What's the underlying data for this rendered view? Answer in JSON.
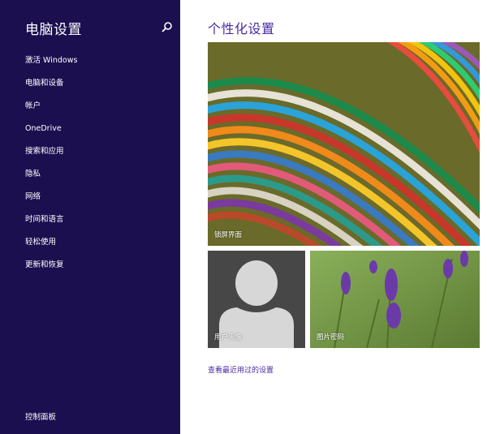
{
  "sidebar": {
    "title": "电脑设置",
    "search_icon": "search-icon",
    "items": [
      {
        "label": "激活 Windows"
      },
      {
        "label": "电脑和设备"
      },
      {
        "label": "帐户"
      },
      {
        "label": "OneDrive"
      },
      {
        "label": "搜索和应用"
      },
      {
        "label": "隐私"
      },
      {
        "label": "网络"
      },
      {
        "label": "时间和语言"
      },
      {
        "label": "轻松使用"
      },
      {
        "label": "更新和恢复"
      }
    ],
    "control_panel": "控制面板"
  },
  "main": {
    "title": "个性化设置",
    "tiles": {
      "lock_screen": "锁屏界面",
      "account_picture": "用户头像",
      "picture_password": "图片密码"
    },
    "recent_link": "查看最近用过的设置"
  },
  "colors": {
    "sidebar_bg": "#1b0f50",
    "accent": "#4a2aa0"
  }
}
